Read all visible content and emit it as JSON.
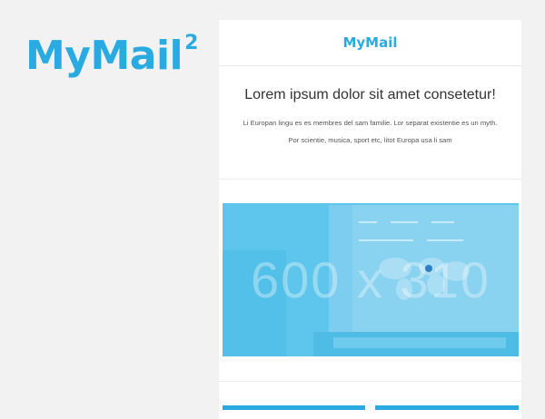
{
  "brand": {
    "name": "MyMail",
    "superscript": "2"
  },
  "email": {
    "header_logo": "MyMail",
    "headline": "Lorem ipsum dolor sit amet consetetur!",
    "body_lines": [
      "Li Europan lingu es es membres del sam familie. Lor separat existentie es un myth.",
      "Por scientie, musica, sport etc, litot Europa usa li sam"
    ],
    "hero_placeholder": "600 x 310"
  },
  "colors": {
    "accent": "#29abe2",
    "hero_overlay": "#5ec6ec",
    "background": "#f2f2f2"
  }
}
